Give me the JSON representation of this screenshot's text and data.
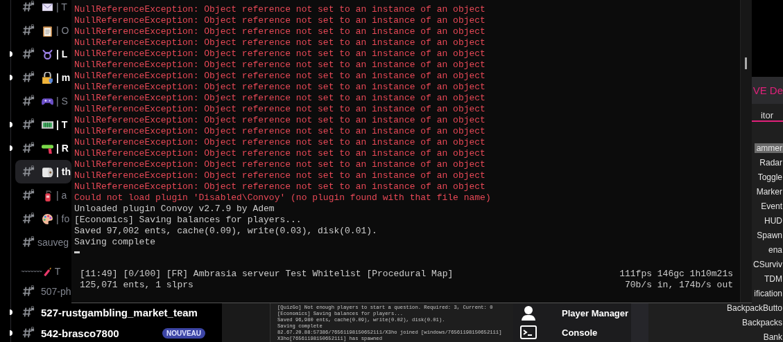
{
  "discord": {
    "channels": [
      {
        "label": "| T",
        "unread": false,
        "selected": false
      },
      {
        "label": "| O",
        "unread": false,
        "selected": false
      },
      {
        "label": "| L",
        "unread": true,
        "selected": false
      },
      {
        "label": "| m",
        "unread": true,
        "selected": false
      },
      {
        "label": "| S",
        "unread": false,
        "selected": false
      },
      {
        "label": "| T",
        "unread": true,
        "selected": false
      },
      {
        "label": "| R",
        "unread": true,
        "selected": false
      },
      {
        "label": "| th",
        "unread": false,
        "selected": true
      },
      {
        "label": "| a",
        "unread": false,
        "selected": false
      },
      {
        "label": "| fo",
        "unread": false,
        "selected": false
      },
      {
        "label": "sauveg",
        "unread": false,
        "selected": false
      }
    ],
    "divider": {
      "rule": "~~~~~~~",
      "label": "T"
    },
    "more_channels": [
      {
        "label": "507-ph",
        "unread": false,
        "selected": false
      },
      {
        "label": "527-rustgambling_market_team",
        "unread": true,
        "selected": false
      },
      {
        "label": "542-brasco7800",
        "unread": true,
        "selected": false,
        "badge": "NOUVEAU"
      }
    ]
  },
  "console": {
    "lines": [
      {
        "kind": "error",
        "text": "NullReferenceException: Object reference not set to an instance of an object"
      },
      {
        "kind": "error",
        "text": "NullReferenceException: Object reference not set to an instance of an object"
      },
      {
        "kind": "error",
        "text": "NullReferenceException: Object reference not set to an instance of an object"
      },
      {
        "kind": "error",
        "text": "NullReferenceException: Object reference not set to an instance of an object"
      },
      {
        "kind": "error",
        "text": "NullReferenceException: Object reference not set to an instance of an object"
      },
      {
        "kind": "error",
        "text": "NullReferenceException: Object reference not set to an instance of an object"
      },
      {
        "kind": "error",
        "text": "NullReferenceException: Object reference not set to an instance of an object"
      },
      {
        "kind": "error",
        "text": "NullReferenceException: Object reference not set to an instance of an object"
      },
      {
        "kind": "error",
        "text": "NullReferenceException: Object reference not set to an instance of an object"
      },
      {
        "kind": "error",
        "text": "NullReferenceException: Object reference not set to an instance of an object"
      },
      {
        "kind": "error",
        "text": "NullReferenceException: Object reference not set to an instance of an object"
      },
      {
        "kind": "error",
        "text": "NullReferenceException: Object reference not set to an instance of an object"
      },
      {
        "kind": "error",
        "text": "NullReferenceException: Object reference not set to an instance of an object"
      },
      {
        "kind": "error",
        "text": "NullReferenceException: Object reference not set to an instance of an object"
      },
      {
        "kind": "error",
        "text": "NullReferenceException: Object reference not set to an instance of an object"
      },
      {
        "kind": "error",
        "text": "NullReferenceException: Object reference not set to an instance of an object"
      },
      {
        "kind": "error",
        "text": "NullReferenceException: Object reference not set to an instance of an object"
      },
      {
        "kind": "error",
        "text": "Could not load plugin 'Disabled\\Convoy' (no plugin found with that file name)"
      },
      {
        "kind": "info",
        "text": "Unloaded plugin Convoy v2.7.9 by Adem"
      },
      {
        "kind": "info",
        "text": "[Economics] Saving balances for players..."
      },
      {
        "kind": "info",
        "text": "Saved 97,002 ents, cache(0.09), write(0.03), disk(0.01)."
      },
      {
        "kind": "info",
        "text": "Saving complete"
      }
    ],
    "status": {
      "left": [
        "[11:49] [0/100] [FR] Ambrasia serveur Test Whitelist [Procedural Map]",
        "125,071 ents, 1 slprs"
      ],
      "right": [
        "111fps 146gc 1h10m21s",
        "70b/s in, 174b/s out"
      ]
    }
  },
  "rcon": {
    "log": [
      "[QuizGo] Not enough players to start a question. Required: 3, Current: 0",
      "[Economics] Saving balances for players...",
      "Saved 96,980 ents, cache(0.09), write(0.02), disk(0.01).",
      "Saving complete",
      "82.67.20.88:57386/76561198150652111/X3ho joined [windows/76561198150652111]",
      "X3ho[76561198150652111] has spawned"
    ],
    "nav": [
      {
        "label": "Player Manager"
      },
      {
        "label": "Console"
      }
    ],
    "panel_title": "VE De",
    "tab": "itor",
    "plugins": [
      {
        "name": "ammer",
        "selected": true
      },
      {
        "name": "Radar",
        "selected": false
      },
      {
        "name": "Toggle",
        "selected": false
      },
      {
        "name": "Marker",
        "selected": false
      },
      {
        "name": "Event",
        "selected": false
      },
      {
        "name": "HUD",
        "selected": false
      },
      {
        "name": "Spawn",
        "selected": false
      },
      {
        "name": "ena",
        "selected": false
      },
      {
        "name": "CSurviv",
        "selected": false
      },
      {
        "name": "TDM",
        "selected": false
      },
      {
        "name": "ification",
        "selected": false
      },
      {
        "name": "BackpackButto",
        "selected": false
      },
      {
        "name": "Backpacks",
        "selected": false
      },
      {
        "name": "Bank",
        "selected": false
      }
    ]
  }
}
